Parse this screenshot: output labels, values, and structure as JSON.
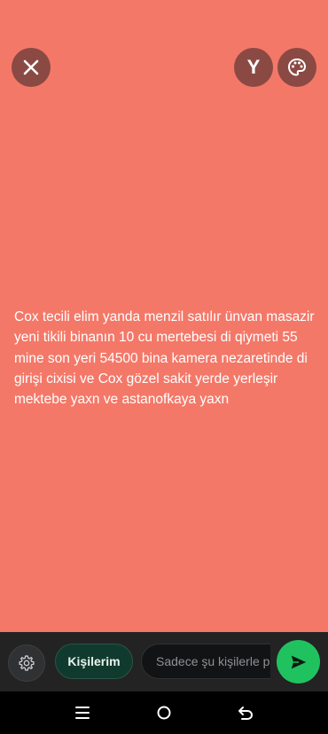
{
  "canvas": {
    "background_color": "#f47868",
    "status_text": "Cox tecili elim yanda menzil satılır ünvan masazir  yeni tikili binanın 10 cu mertebesi di qiymeti 55 mine son yeri 54500 bina kamera nezaretinde di girişi cixisi ve Cox gözel sakit yerde yerleşir mektebe yaxn ve astanofkaya yaxn"
  },
  "top_controls": {
    "close_icon": "close-icon",
    "font_button_label": "Y",
    "palette_icon": "palette-icon"
  },
  "bottom_bar": {
    "settings_icon": "gear-icon",
    "audience_chip_label": "Kişilerim",
    "audience_input_placeholder": "Sadece şu kişilerle p",
    "send_icon": "send-icon",
    "accent_color": "#20c25f"
  },
  "nav_bar": {
    "menu_icon": "menu-icon",
    "home_icon": "home-icon",
    "back_icon": "back-icon"
  }
}
